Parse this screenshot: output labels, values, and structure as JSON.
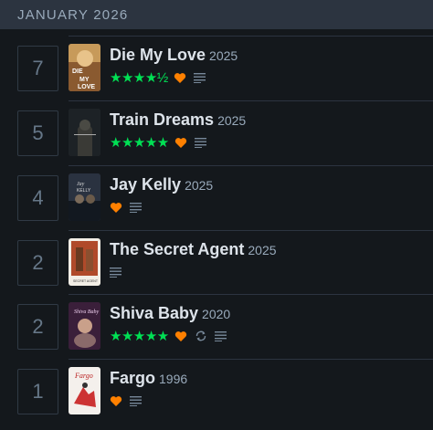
{
  "month": {
    "label": "JANUARY 2026"
  },
  "colors": {
    "star": "#00e054",
    "heart": "#ff8000",
    "icon": "#778899"
  },
  "entries": [
    {
      "day": "7",
      "title": "Die My Love",
      "year": "2025",
      "stars": "★★★★½",
      "liked": true,
      "review": true,
      "rewatch": false,
      "poster": "die-my-love"
    },
    {
      "day": "5",
      "title": "Train Dreams",
      "year": "2025",
      "stars": "★★★★★",
      "liked": true,
      "review": true,
      "rewatch": false,
      "poster": "train-dreams"
    },
    {
      "day": "4",
      "title": "Jay Kelly",
      "year": "2025",
      "stars": "",
      "liked": true,
      "review": true,
      "rewatch": false,
      "poster": "jay-kelly"
    },
    {
      "day": "2",
      "title": "The Secret Agent",
      "year": "2025",
      "stars": "",
      "liked": false,
      "review": true,
      "rewatch": false,
      "poster": "the-secret-agent"
    },
    {
      "day": "2",
      "title": "Shiva Baby",
      "year": "2020",
      "stars": "★★★★★",
      "liked": true,
      "review": true,
      "rewatch": true,
      "poster": "shiva-baby"
    },
    {
      "day": "1",
      "title": "Fargo",
      "year": "1996",
      "stars": "",
      "liked": true,
      "review": true,
      "rewatch": false,
      "poster": "fargo"
    }
  ],
  "poster_text": {
    "die-my-love": "DIE MY LOVE",
    "jay-kelly": "Jay KELLY",
    "the-secret-agent": "SECRET AGENT",
    "shiva-baby": "Shiva Baby",
    "fargo": "Fargo"
  }
}
